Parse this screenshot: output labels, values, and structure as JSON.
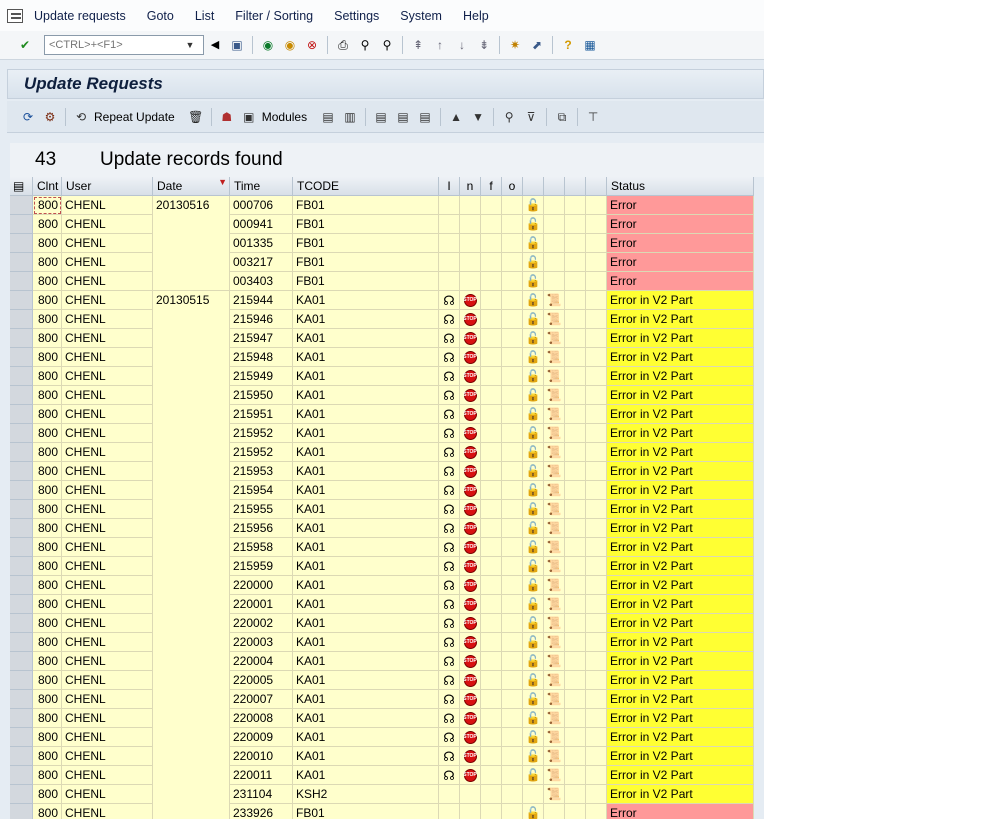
{
  "menu": [
    "Update requests",
    "Goto",
    "List",
    "Filter / Sorting",
    "Settings",
    "System",
    "Help"
  ],
  "command_field": {
    "placeholder": "<CTRL>+<F1>"
  },
  "title": "Update Requests",
  "app_toolbar": {
    "repeat_update": "Repeat Update",
    "modules": "Modules"
  },
  "summary": {
    "count": "43",
    "text": "Update records found"
  },
  "columns": {
    "clnt": "Clnt",
    "user": "User",
    "date": "Date",
    "time": "Time",
    "tcode": "TCODE",
    "i": "I",
    "n": "n",
    "f": "f",
    "o": "o",
    "status": "Status"
  },
  "status_colors": {
    "Error": "#ff9999",
    "Error in V2 Part": "#ffff33"
  },
  "rows": [
    {
      "clnt": "800",
      "user": "CHENL",
      "date": "20130516",
      "time": "000706",
      "tcode": "FB01",
      "v2": false,
      "lock": true,
      "scroll": false,
      "status": "Error"
    },
    {
      "clnt": "800",
      "user": "CHENL",
      "date": "",
      "time": "000941",
      "tcode": "FB01",
      "v2": false,
      "lock": true,
      "scroll": false,
      "status": "Error"
    },
    {
      "clnt": "800",
      "user": "CHENL",
      "date": "",
      "time": "001335",
      "tcode": "FB01",
      "v2": false,
      "lock": true,
      "scroll": false,
      "status": "Error"
    },
    {
      "clnt": "800",
      "user": "CHENL",
      "date": "",
      "time": "003217",
      "tcode": "FB01",
      "v2": false,
      "lock": true,
      "scroll": false,
      "status": "Error"
    },
    {
      "clnt": "800",
      "user": "CHENL",
      "date": "",
      "time": "003403",
      "tcode": "FB01",
      "v2": false,
      "lock": true,
      "scroll": false,
      "status": "Error"
    },
    {
      "clnt": "800",
      "user": "CHENL",
      "date": "20130515",
      "time": "215944",
      "tcode": "KA01",
      "v2": true,
      "lock": true,
      "scroll": true,
      "status": "Error in V2 Part"
    },
    {
      "clnt": "800",
      "user": "CHENL",
      "date": "",
      "time": "215946",
      "tcode": "KA01",
      "v2": true,
      "lock": true,
      "scroll": true,
      "status": "Error in V2 Part"
    },
    {
      "clnt": "800",
      "user": "CHENL",
      "date": "",
      "time": "215947",
      "tcode": "KA01",
      "v2": true,
      "lock": true,
      "scroll": true,
      "status": "Error in V2 Part"
    },
    {
      "clnt": "800",
      "user": "CHENL",
      "date": "",
      "time": "215948",
      "tcode": "KA01",
      "v2": true,
      "lock": true,
      "scroll": true,
      "status": "Error in V2 Part"
    },
    {
      "clnt": "800",
      "user": "CHENL",
      "date": "",
      "time": "215949",
      "tcode": "KA01",
      "v2": true,
      "lock": true,
      "scroll": true,
      "status": "Error in V2 Part"
    },
    {
      "clnt": "800",
      "user": "CHENL",
      "date": "",
      "time": "215950",
      "tcode": "KA01",
      "v2": true,
      "lock": true,
      "scroll": true,
      "status": "Error in V2 Part"
    },
    {
      "clnt": "800",
      "user": "CHENL",
      "date": "",
      "time": "215951",
      "tcode": "KA01",
      "v2": true,
      "lock": true,
      "scroll": true,
      "status": "Error in V2 Part"
    },
    {
      "clnt": "800",
      "user": "CHENL",
      "date": "",
      "time": "215952",
      "tcode": "KA01",
      "v2": true,
      "lock": true,
      "scroll": true,
      "status": "Error in V2 Part"
    },
    {
      "clnt": "800",
      "user": "CHENL",
      "date": "",
      "time": "215952",
      "tcode": "KA01",
      "v2": true,
      "lock": true,
      "scroll": true,
      "status": "Error in V2 Part"
    },
    {
      "clnt": "800",
      "user": "CHENL",
      "date": "",
      "time": "215953",
      "tcode": "KA01",
      "v2": true,
      "lock": true,
      "scroll": true,
      "status": "Error in V2 Part"
    },
    {
      "clnt": "800",
      "user": "CHENL",
      "date": "",
      "time": "215954",
      "tcode": "KA01",
      "v2": true,
      "lock": true,
      "scroll": true,
      "status": "Error in V2 Part"
    },
    {
      "clnt": "800",
      "user": "CHENL",
      "date": "",
      "time": "215955",
      "tcode": "KA01",
      "v2": true,
      "lock": true,
      "scroll": true,
      "status": "Error in V2 Part"
    },
    {
      "clnt": "800",
      "user": "CHENL",
      "date": "",
      "time": "215956",
      "tcode": "KA01",
      "v2": true,
      "lock": true,
      "scroll": true,
      "status": "Error in V2 Part"
    },
    {
      "clnt": "800",
      "user": "CHENL",
      "date": "",
      "time": "215958",
      "tcode": "KA01",
      "v2": true,
      "lock": true,
      "scroll": true,
      "status": "Error in V2 Part"
    },
    {
      "clnt": "800",
      "user": "CHENL",
      "date": "",
      "time": "215959",
      "tcode": "KA01",
      "v2": true,
      "lock": true,
      "scroll": true,
      "status": "Error in V2 Part"
    },
    {
      "clnt": "800",
      "user": "CHENL",
      "date": "",
      "time": "220000",
      "tcode": "KA01",
      "v2": true,
      "lock": true,
      "scroll": true,
      "status": "Error in V2 Part"
    },
    {
      "clnt": "800",
      "user": "CHENL",
      "date": "",
      "time": "220001",
      "tcode": "KA01",
      "v2": true,
      "lock": true,
      "scroll": true,
      "status": "Error in V2 Part"
    },
    {
      "clnt": "800",
      "user": "CHENL",
      "date": "",
      "time": "220002",
      "tcode": "KA01",
      "v2": true,
      "lock": true,
      "scroll": true,
      "status": "Error in V2 Part"
    },
    {
      "clnt": "800",
      "user": "CHENL",
      "date": "",
      "time": "220003",
      "tcode": "KA01",
      "v2": true,
      "lock": true,
      "scroll": true,
      "status": "Error in V2 Part"
    },
    {
      "clnt": "800",
      "user": "CHENL",
      "date": "",
      "time": "220004",
      "tcode": "KA01",
      "v2": true,
      "lock": true,
      "scroll": true,
      "status": "Error in V2 Part"
    },
    {
      "clnt": "800",
      "user": "CHENL",
      "date": "",
      "time": "220005",
      "tcode": "KA01",
      "v2": true,
      "lock": true,
      "scroll": true,
      "status": "Error in V2 Part"
    },
    {
      "clnt": "800",
      "user": "CHENL",
      "date": "",
      "time": "220007",
      "tcode": "KA01",
      "v2": true,
      "lock": true,
      "scroll": true,
      "status": "Error in V2 Part"
    },
    {
      "clnt": "800",
      "user": "CHENL",
      "date": "",
      "time": "220008",
      "tcode": "KA01",
      "v2": true,
      "lock": true,
      "scroll": true,
      "status": "Error in V2 Part"
    },
    {
      "clnt": "800",
      "user": "CHENL",
      "date": "",
      "time": "220009",
      "tcode": "KA01",
      "v2": true,
      "lock": true,
      "scroll": true,
      "status": "Error in V2 Part"
    },
    {
      "clnt": "800",
      "user": "CHENL",
      "date": "",
      "time": "220010",
      "tcode": "KA01",
      "v2": true,
      "lock": true,
      "scroll": true,
      "status": "Error in V2 Part"
    },
    {
      "clnt": "800",
      "user": "CHENL",
      "date": "",
      "time": "220011",
      "tcode": "KA01",
      "v2": true,
      "lock": true,
      "scroll": true,
      "status": "Error in V2 Part"
    },
    {
      "clnt": "800",
      "user": "CHENL",
      "date": "",
      "time": "231104",
      "tcode": "KSH2",
      "v2": false,
      "lock": false,
      "scroll": true,
      "status": "Error in V2 Part"
    },
    {
      "clnt": "800",
      "user": "CHENL",
      "date": "",
      "time": "233926",
      "tcode": "FB01",
      "v2": false,
      "lock": true,
      "scroll": false,
      "status": "Error"
    }
  ]
}
